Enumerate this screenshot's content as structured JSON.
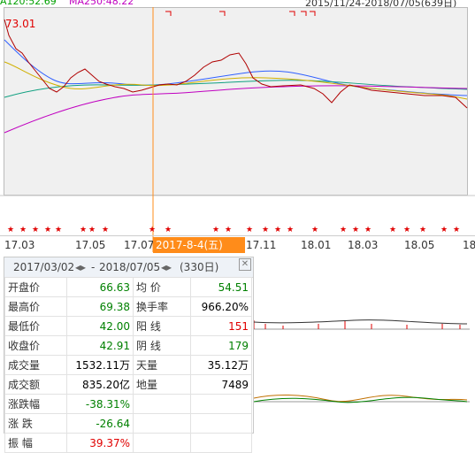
{
  "header": {
    "ma120": "A120:52.69",
    "ma250": "MA250:48.22",
    "range": "2015/11/24-2018/07/05(639日)",
    "window_buttons": "▢ ⊗"
  },
  "main_chart": {
    "high_label": "73.01"
  },
  "axis": {
    "ticks": [
      "17.03",
      "17.05",
      "17.07",
      "17.11",
      "18.01",
      "18.03",
      "18.05",
      "18"
    ],
    "cursor_date": "2017-8-4(五)"
  },
  "stars": "★",
  "panel": {
    "start": "2017/03/02",
    "end": "2018/07/05",
    "nav_arrows": "◂▸",
    "dash": "-",
    "days": "(330日)",
    "close": "✕",
    "rows": [
      {
        "label": "开盘价",
        "value": "66.63",
        "label2": "均  价",
        "value2": "54.51"
      },
      {
        "label": "最高价",
        "value": "69.38",
        "label2": "换手率",
        "value2": "966.20%"
      },
      {
        "label": "最低价",
        "value": "42.00",
        "label2": "阳  线",
        "value2": "151"
      },
      {
        "label": "收盘价",
        "value": "42.91",
        "label2": "阴  线",
        "value2": "179"
      },
      {
        "label": "成交量",
        "value": "1532.11万",
        "label2": "天量",
        "value2": "35.12万"
      },
      {
        "label": "成交额",
        "value": "835.20亿",
        "label2": "地量",
        "value2": "7489"
      },
      {
        "label": "涨跌幅",
        "value": "-38.31%",
        "label2": "",
        "value2": ""
      },
      {
        "label": "涨  跌",
        "value": "-26.64",
        "label2": "",
        "value2": ""
      },
      {
        "label": "振  幅",
        "value": "39.37%",
        "label2": "",
        "value2": ""
      }
    ]
  },
  "colors": {
    "up": "#e00000",
    "down": "#008000",
    "ma_purple": "#c000c0",
    "cursor": "#ff8c1a"
  }
}
